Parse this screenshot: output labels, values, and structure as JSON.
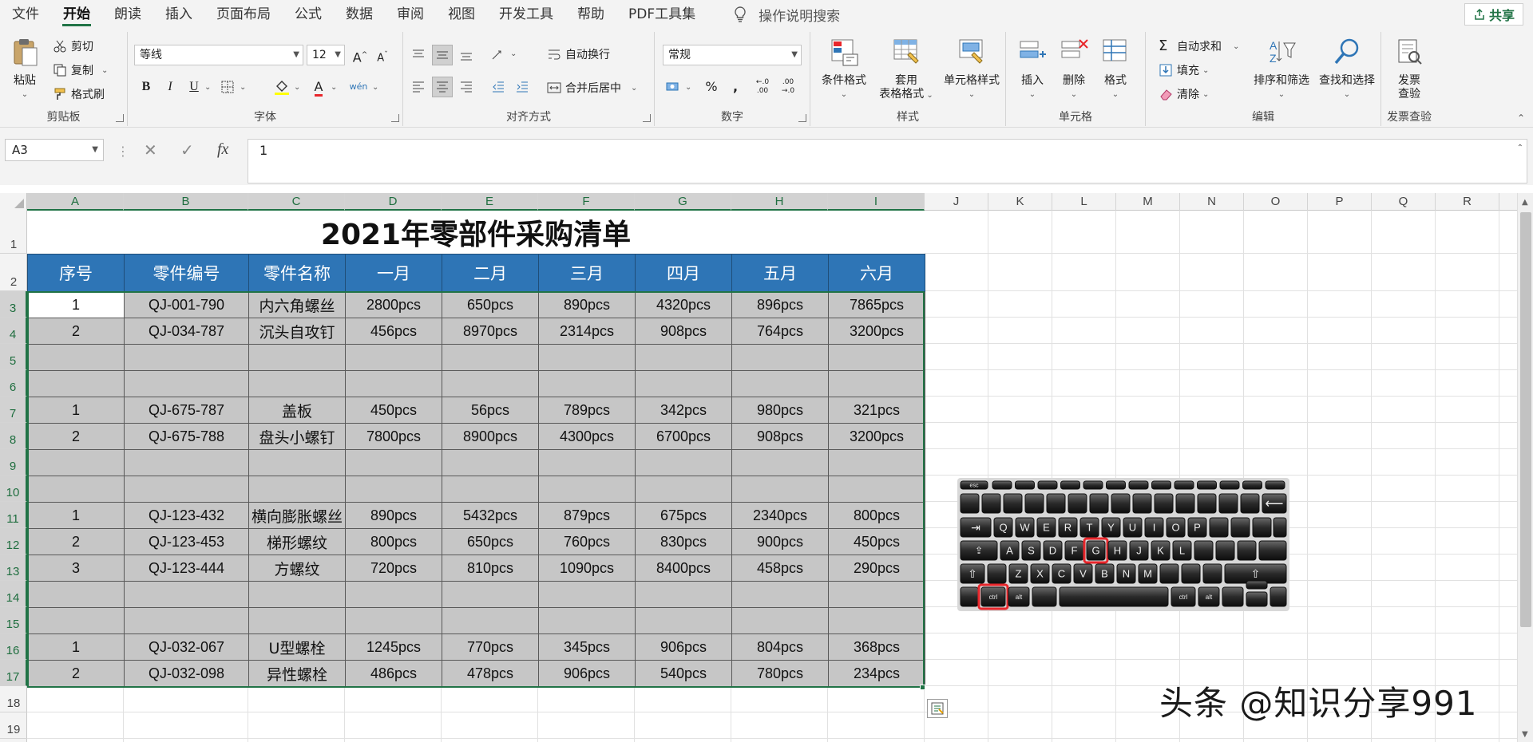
{
  "menu": {
    "items": [
      "文件",
      "开始",
      "朗读",
      "插入",
      "页面布局",
      "公式",
      "数据",
      "审阅",
      "视图",
      "开发工具",
      "帮助",
      "PDF工具集"
    ],
    "active_index": 1,
    "tell_me": "操作说明搜索",
    "share": "共享"
  },
  "ribbon": {
    "clipboard": {
      "label": "剪贴板",
      "paste": "粘贴",
      "cut": "剪切",
      "copy": "复制",
      "format_painter": "格式刷"
    },
    "font": {
      "label": "字体",
      "font_name": "等线",
      "font_size": "12",
      "grow": "A",
      "shrink": "A",
      "bold": "B",
      "italic": "I",
      "underline": "U",
      "font_color_glyph": "A",
      "phonetic_glyph": "wén"
    },
    "alignment": {
      "label": "对齐方式",
      "wrap_text": "自动换行",
      "merge_center": "合并后居中"
    },
    "number": {
      "label": "数字",
      "format": "常规",
      "percent": "%",
      "comma": ",",
      "inc_decimal": "←.0 .00",
      "dec_decimal": ".00 →.0"
    },
    "styles": {
      "label": "样式",
      "conditional": "条件格式",
      "table_format_1": "套用",
      "table_format_2": "表格格式",
      "cell_styles": "单元格样式"
    },
    "cells": {
      "label": "单元格",
      "insert": "插入",
      "delete": "删除",
      "format": "格式"
    },
    "editing": {
      "label": "编辑",
      "autosum": "自动求和",
      "fill": "填充",
      "clear": "清除",
      "sort_filter": "排序和筛选",
      "find_select": "查找和选择"
    },
    "invoice": {
      "label": "发票查验",
      "check_1": "发票",
      "check_2": "查验"
    }
  },
  "formula_bar": {
    "name_box": "A3",
    "formula": "1",
    "fx": "fx"
  },
  "columns": [
    "A",
    "B",
    "C",
    "D",
    "E",
    "F",
    "G",
    "H",
    "I",
    "J",
    "K",
    "L",
    "M",
    "N",
    "O",
    "P",
    "Q",
    "R"
  ],
  "rows": [
    "1",
    "2",
    "3",
    "4",
    "5",
    "6",
    "7",
    "8",
    "9",
    "10",
    "11",
    "12",
    "13",
    "14",
    "15",
    "16",
    "17",
    "18",
    "19"
  ],
  "sheet": {
    "title": "2021年零部件采购清单",
    "headers": [
      "序号",
      "零件编号",
      "零件名称",
      "一月",
      "二月",
      "三月",
      "四月",
      "五月",
      "六月"
    ],
    "rows": [
      [
        "1",
        "QJ-001-790",
        "内六角螺丝",
        "2800pcs",
        "650pcs",
        "890pcs",
        "4320pcs",
        "896pcs",
        "7865pcs"
      ],
      [
        "2",
        "QJ-034-787",
        "沉头自攻钉",
        "456pcs",
        "8970pcs",
        "2314pcs",
        "908pcs",
        "764pcs",
        "3200pcs"
      ],
      [
        "",
        "",
        "",
        "",
        "",
        "",
        "",
        "",
        ""
      ],
      [
        "",
        "",
        "",
        "",
        "",
        "",
        "",
        "",
        ""
      ],
      [
        "1",
        "QJ-675-787",
        "盖板",
        "450pcs",
        "56pcs",
        "789pcs",
        "342pcs",
        "980pcs",
        "321pcs"
      ],
      [
        "2",
        "QJ-675-788",
        "盘头小螺钉",
        "7800pcs",
        "8900pcs",
        "4300pcs",
        "6700pcs",
        "908pcs",
        "3200pcs"
      ],
      [
        "",
        "",
        "",
        "",
        "",
        "",
        "",
        "",
        ""
      ],
      [
        "",
        "",
        "",
        "",
        "",
        "",
        "",
        "",
        ""
      ],
      [
        "1",
        "QJ-123-432",
        "横向膨胀螺丝",
        "890pcs",
        "5432pcs",
        "879pcs",
        "675pcs",
        "2340pcs",
        "800pcs"
      ],
      [
        "2",
        "QJ-123-453",
        "梯形螺纹",
        "800pcs",
        "650pcs",
        "760pcs",
        "830pcs",
        "900pcs",
        "450pcs"
      ],
      [
        "3",
        "QJ-123-444",
        "方螺纹",
        "720pcs",
        "810pcs",
        "1090pcs",
        "8400pcs",
        "458pcs",
        "290pcs"
      ],
      [
        "",
        "",
        "",
        "",
        "",
        "",
        "",
        "",
        ""
      ],
      [
        "",
        "",
        "",
        "",
        "",
        "",
        "",
        "",
        ""
      ],
      [
        "1",
        "QJ-032-067",
        "U型螺栓",
        "1245pcs",
        "770pcs",
        "345pcs",
        "906pcs",
        "804pcs",
        "368pcs"
      ],
      [
        "2",
        "QJ-032-098",
        "异性螺栓",
        "486pcs",
        "478pcs",
        "906pcs",
        "540pcs",
        "780pcs",
        "234pcs"
      ]
    ]
  },
  "keyboard": {
    "highlighted": [
      "G",
      "ctrl"
    ],
    "row1": [
      "Q",
      "W",
      "E",
      "R",
      "T",
      "Y",
      "U",
      "I",
      "O",
      "P"
    ],
    "row2": [
      "A",
      "S",
      "D",
      "F",
      "G",
      "H",
      "J",
      "K",
      "L"
    ],
    "row3": [
      "Z",
      "X",
      "C",
      "V",
      "B",
      "N",
      "M"
    ],
    "ctrl": "ctrl",
    "alt": "alt",
    "esc": "esc"
  },
  "watermark": "头条 @知识分享991",
  "colors": {
    "accent": "#217346",
    "header_fill": "#2e75b6",
    "cell_fill": "#c6c6c6",
    "highlight": "#e8262b"
  }
}
